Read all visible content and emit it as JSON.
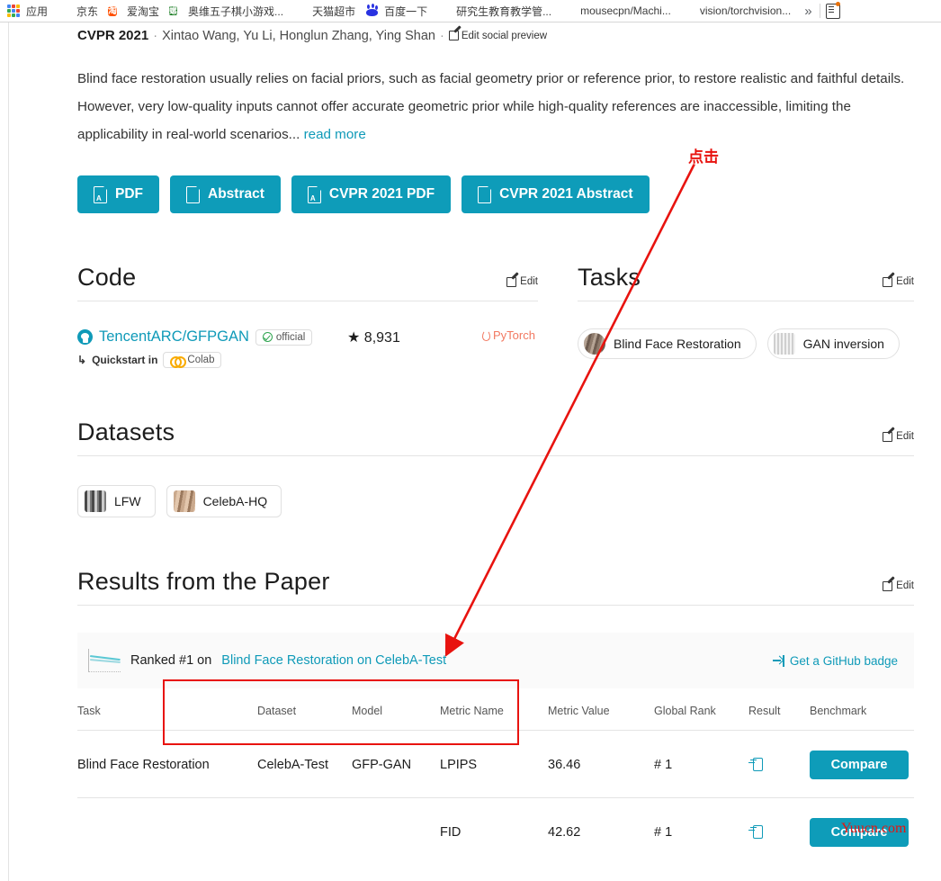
{
  "browser": {
    "bookmarks": [
      {
        "label": "应用",
        "icon": "apps-grid-icon"
      },
      {
        "label": "京东",
        "icon": "globe-icon"
      },
      {
        "label": "爱淘宝",
        "icon": "taobao-icon"
      },
      {
        "label": "奥维五子棋小游戏...",
        "icon": "green-square-icon"
      },
      {
        "label": "天猫超市",
        "icon": "globe-icon"
      },
      {
        "label": "百度一下",
        "icon": "baidu-paw-icon"
      },
      {
        "label": "研究生教育教学管...",
        "icon": "globe-icon"
      },
      {
        "label": "mousecpn/Machi...",
        "icon": "github-icon"
      },
      {
        "label": "vision/torchvision...",
        "icon": "github-icon"
      }
    ],
    "overflow_label": "»",
    "reading_list": "reading-list-icon"
  },
  "paper": {
    "venue": "CVPR 2021",
    "separator": "·",
    "authors": "Xintao Wang, Yu Li, Honglun Zhang, Ying Shan",
    "edit_social_preview": "Edit social preview",
    "abstract": "Blind face restoration usually relies on facial priors, such as facial geometry prior or reference prior, to restore realistic and faithful details. However, very low-quality inputs cannot offer accurate geometric prior while high-quality references are inaccessible, limiting the applicability in real-world scenarios...",
    "read_more": "read more"
  },
  "actions": [
    {
      "label": "PDF",
      "icon": "pdf-file-icon"
    },
    {
      "label": "Abstract",
      "icon": "file-icon"
    },
    {
      "label": "CVPR 2021 PDF",
      "icon": "pdf-file-icon"
    },
    {
      "label": "CVPR 2021 Abstract",
      "icon": "file-icon"
    }
  ],
  "code": {
    "title": "Code",
    "edit_label": "Edit",
    "repo_name": "TencentARC/GFPGAN",
    "official_badge": "official",
    "quickstart_label": "Quickstart in",
    "colab_badge": "Colab",
    "stars": "8,931",
    "star_glyph": "★",
    "framework": "PyTorch"
  },
  "tasks": {
    "title": "Tasks",
    "edit_label": "Edit",
    "chips": [
      {
        "label": "Blind Face Restoration",
        "thumb": "face-thumbnail"
      },
      {
        "label": "GAN inversion",
        "thumb": "bars-thumbnail"
      }
    ]
  },
  "datasets": {
    "title": "Datasets",
    "edit_label": "Edit",
    "chips": [
      {
        "label": "LFW",
        "thumb": "lfw-thumbnail"
      },
      {
        "label": "CelebA-HQ",
        "thumb": "celeba-thumbnail"
      }
    ]
  },
  "results": {
    "title": "Results from the Paper",
    "edit_label": "Edit",
    "ranked_prefix": "Ranked #1 on",
    "ranked_link": "Blind Face Restoration on CelebA-Test",
    "github_badge": "Get a GitHub badge",
    "columns": [
      "Task",
      "Dataset",
      "Model",
      "Metric Name",
      "Metric Value",
      "Global Rank",
      "Result",
      "Benchmark"
    ],
    "rows": [
      {
        "task": "Blind Face Restoration",
        "dataset": "CelebA-Test",
        "model": "GFP-GAN",
        "metric_name": "LPIPS",
        "metric_value": "36.46",
        "global_rank": "# 1",
        "result_icon": "result-link-icon",
        "benchmark": "Compare"
      },
      {
        "task": "",
        "dataset": "",
        "model": "",
        "metric_name": "FID",
        "metric_value": "42.62",
        "global_rank": "# 1",
        "result_icon": "result-link-icon",
        "benchmark": "Compare"
      }
    ]
  },
  "annotations": {
    "click_label": "点击",
    "watermark": "Yuucn.com",
    "accent_red": "#e8130f"
  },
  "colors": {
    "teal": "#0e9cb9",
    "link": "#0f9ab8",
    "text": "#1d1d1d"
  }
}
